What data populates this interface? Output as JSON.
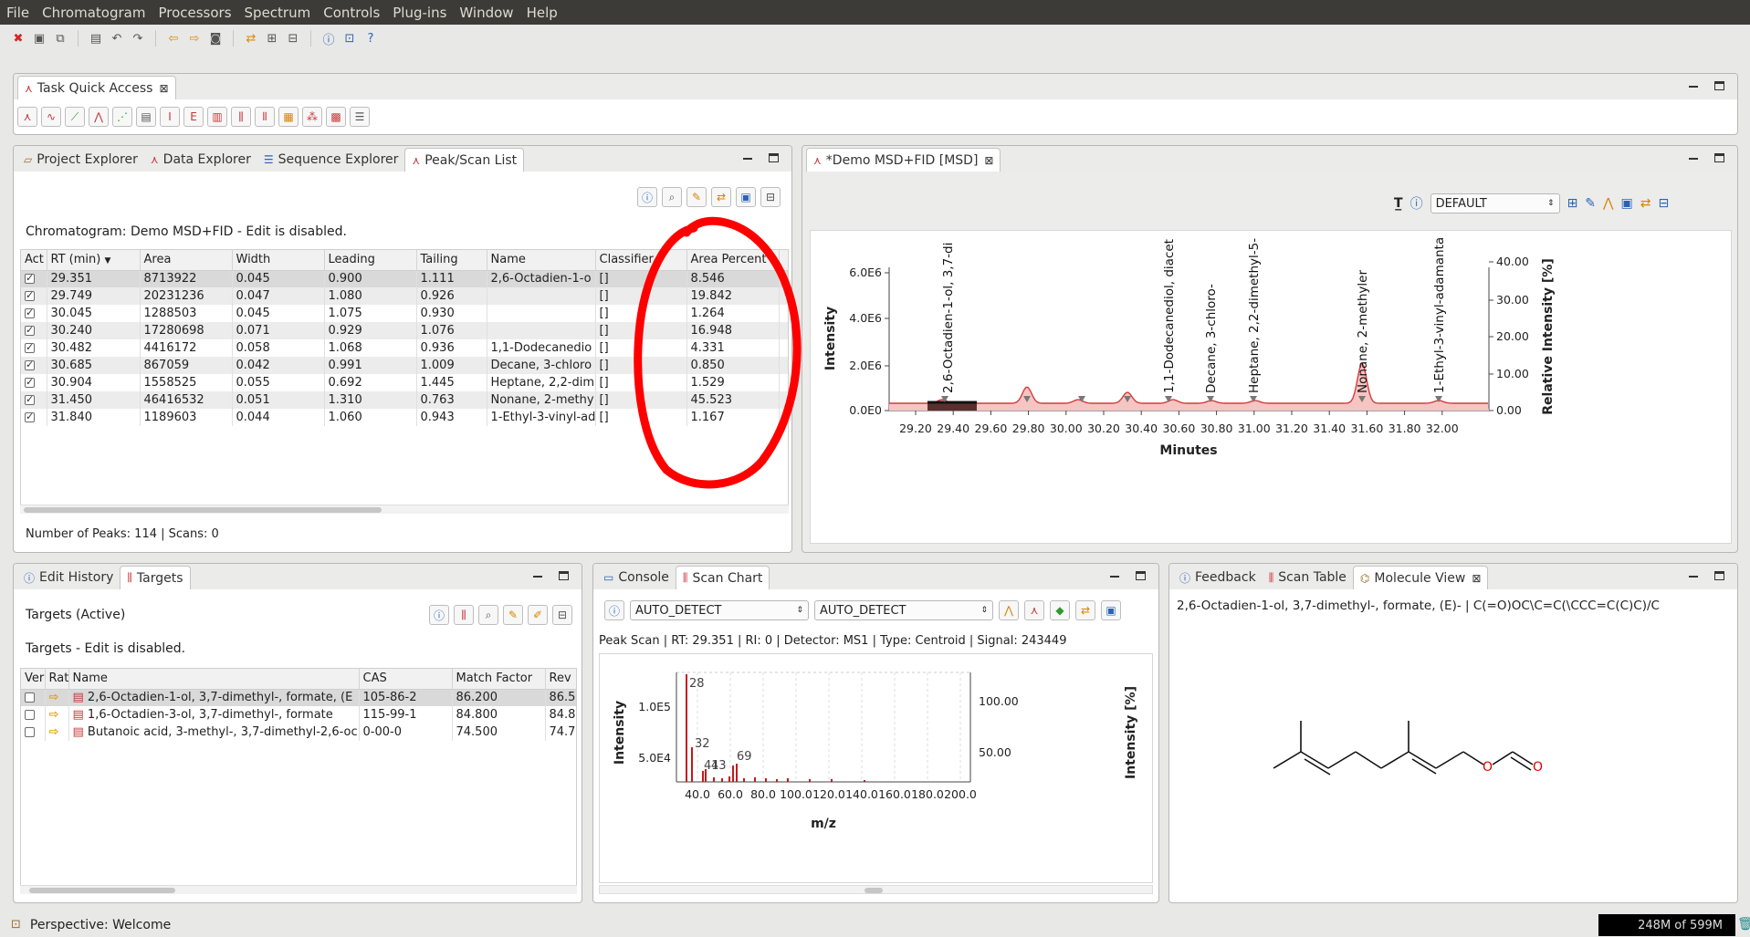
{
  "menubar": [
    "File",
    "Chromatogram",
    "Processors",
    "Spectrum",
    "Controls",
    "Plug-ins",
    "Window",
    "Help"
  ],
  "taskQuickAccess": {
    "title": "Task Quick Access"
  },
  "leftTabs": [
    "Project Explorer",
    "Data Explorer",
    "Sequence Explorer",
    "Peak/Scan List"
  ],
  "peakList": {
    "info": "Chromatogram: Demo MSD+FID - Edit is disabled.",
    "columns": [
      "Act",
      "RT (min)",
      "Area",
      "Width",
      "Leading",
      "Tailing",
      "Name",
      "Classifier",
      "Area Percent"
    ],
    "rows": [
      [
        "29.351",
        "8713922",
        "0.045",
        "0.900",
        "1.111",
        "2,6-Octadien-1-o",
        "[]",
        "8.546"
      ],
      [
        "29.749",
        "20231236",
        "0.047",
        "1.080",
        "0.926",
        "",
        "[]",
        "19.842"
      ],
      [
        "30.045",
        "1288503",
        "0.045",
        "1.075",
        "0.930",
        "",
        "[]",
        "1.264"
      ],
      [
        "30.240",
        "17280698",
        "0.071",
        "0.929",
        "1.076",
        "",
        "[]",
        "16.948"
      ],
      [
        "30.482",
        "4416172",
        "0.058",
        "1.068",
        "0.936",
        "1,1-Dodecanedio",
        "[]",
        "4.331"
      ],
      [
        "30.685",
        "867059",
        "0.042",
        "0.991",
        "1.009",
        "Decane, 3-chloro",
        "[]",
        "0.850"
      ],
      [
        "30.904",
        "1558525",
        "0.055",
        "0.692",
        "1.445",
        "Heptane, 2,2-dim",
        "[]",
        "1.529"
      ],
      [
        "31.450",
        "46416532",
        "0.051",
        "1.310",
        "0.763",
        "Nonane, 2-methy",
        "[]",
        "45.523"
      ],
      [
        "31.840",
        "1189603",
        "0.044",
        "1.060",
        "0.943",
        "1-Ethyl-3-vinyl-ad",
        "[]",
        "1.167"
      ]
    ],
    "footer": "Number of Peaks: 114 | Scans: 0"
  },
  "chromEditor": {
    "tab": "*Demo MSD+FID [MSD]",
    "combo": "DEFAULT",
    "yLabel": "Intensity",
    "y2Label": "Relative Intensity [%]",
    "xLabel": "Minutes",
    "yTicks": [
      "6.0E6",
      "4.0E6",
      "2.0E6",
      "0.0E0"
    ],
    "y2Ticks": [
      "40.00",
      "30.00",
      "20.00",
      "10.00",
      "0.00"
    ],
    "xTicks": [
      "29.20",
      "29.40",
      "29.60",
      "29.80",
      "30.00",
      "30.20",
      "30.40",
      "30.60",
      "30.80",
      "31.00",
      "31.20",
      "31.40",
      "31.60",
      "31.80",
      "32.00"
    ],
    "peakLabels": [
      "2,6-Octadien-1-ol, 3,7-di",
      "1,1-Dodecanediol, diacet",
      "Decane, 3-chloro-",
      "Heptane, 2,2-dimethyl-5-",
      "Nonane, 2-methyler",
      "1-Ethyl-3-vinyl-adamanta"
    ]
  },
  "targetsPanel": {
    "tabs": [
      "Edit History",
      "Targets"
    ],
    "title": "Targets (Active)",
    "info": "Targets - Edit is disabled.",
    "columns": [
      "Ver",
      "Rat",
      "Name",
      "CAS",
      "Match Factor",
      "Rev"
    ],
    "rows": [
      [
        "2,6-Octadien-1-ol, 3,7-dimethyl-, formate, (E",
        "105-86-2",
        "86.200",
        "86.5"
      ],
      [
        "1,6-Octadien-3-ol, 3,7-dimethyl-, formate",
        "115-99-1",
        "84.800",
        "84.8"
      ],
      [
        "Butanoic acid, 3-methyl-, 3,7-dimethyl-2,6-oc",
        "0-00-0",
        "74.500",
        "74.7"
      ]
    ]
  },
  "scanPanel": {
    "tabs": [
      "Console",
      "Scan Chart"
    ],
    "combo1": "AUTO_DETECT",
    "combo2": "AUTO_DETECT",
    "info": "Peak Scan | RT: 29.351 | RI: 0 | Detector: MS1 | Type: Centroid | Signal: 243449",
    "yLabel": "Intensity",
    "y2Label": "Intensity [%]",
    "xLabel": "m/z",
    "yTicks": [
      "1.0E5",
      "5.0E4"
    ],
    "y2Ticks": [
      "100.00",
      "50.00"
    ],
    "xTicks": [
      "40.0",
      "60.0",
      "80.0",
      "100.0",
      "120.0",
      "140.0",
      "160.0",
      "180.0",
      "200.0"
    ],
    "peakLabels": [
      "28",
      "32",
      "41",
      "43",
      "69"
    ]
  },
  "moleculePanel": {
    "tabs": [
      "Feedback",
      "Scan Table",
      "Molecule View"
    ],
    "smiles": "2,6-Octadien-1-ol, 3,7-dimethyl-, formate, (E)- | C(=O)OC\\C=C(\\CCC=C(C)C)/C",
    "atoms": [
      "O",
      "O"
    ]
  },
  "status": {
    "perspective": "Perspective: Welcome",
    "memory": "248M of 599M"
  },
  "colors": {
    "accent": "#d23c3c",
    "annotation": "#ff0000"
  }
}
